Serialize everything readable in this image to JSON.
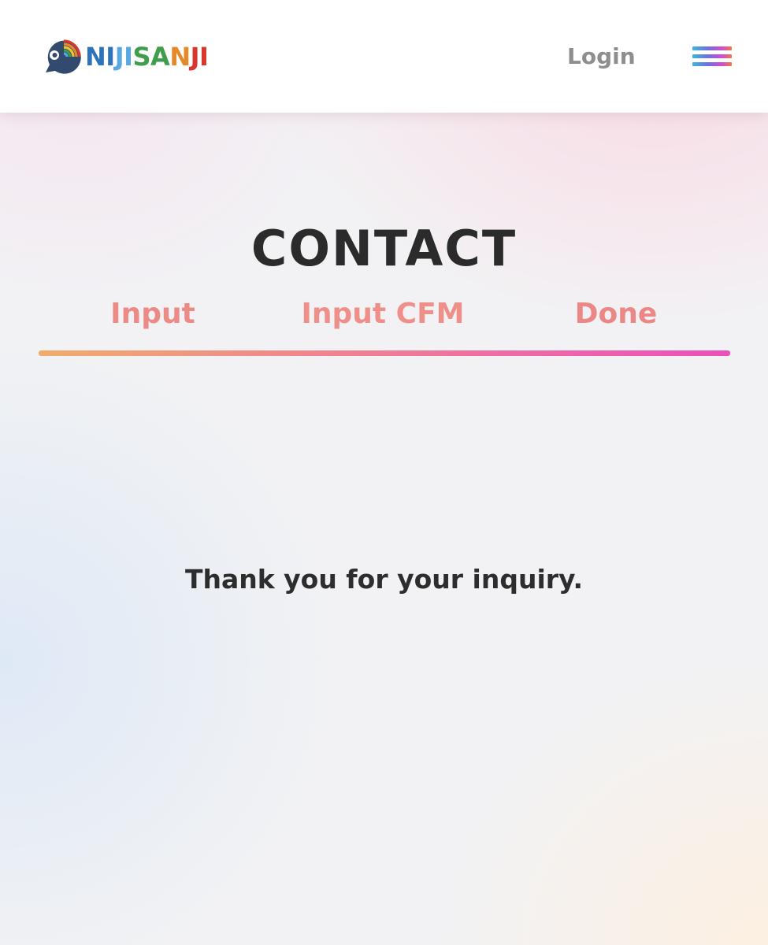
{
  "header": {
    "logo": {
      "letters": [
        {
          "char": "N",
          "color": "#2f73bd"
        },
        {
          "char": "I",
          "color": "#2f73bd"
        },
        {
          "char": "J",
          "color": "#5aa8e0"
        },
        {
          "char": "I",
          "color": "#5aa8e0"
        },
        {
          "char": "S",
          "color": "#3f9e4c"
        },
        {
          "char": "A",
          "color": "#3f9e4c"
        },
        {
          "char": "N",
          "color": "#e58a2a"
        },
        {
          "char": "J",
          "color": "#d8372f"
        },
        {
          "char": "I",
          "color": "#d8372f"
        }
      ],
      "icon": "speech-bubble-rainbow-icon",
      "bubble_color": "#324a6e"
    },
    "login_label": "Login",
    "menu_icon": "hamburger-menu-icon"
  },
  "main": {
    "title": "CONTACT",
    "steps": [
      {
        "label": "Input"
      },
      {
        "label": "Input CFM"
      },
      {
        "label": "Done"
      }
    ],
    "message": "Thank you for your inquiry."
  },
  "colors": {
    "title_text": "#2b2b2b",
    "step_text": "#ec8a86",
    "step_bar_start": "#f0ac6c",
    "step_bar_end": "#ea50bc",
    "login_text": "#8e8e8e"
  }
}
